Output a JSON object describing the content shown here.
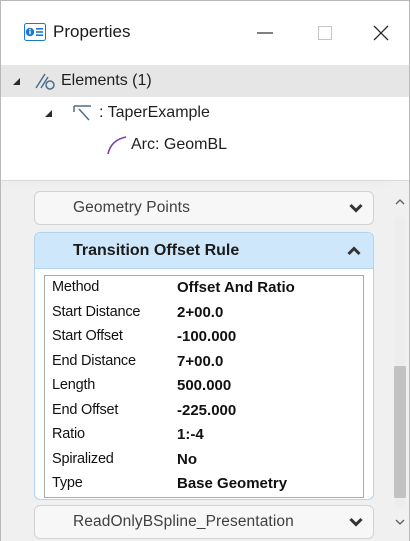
{
  "window": {
    "title": "Properties",
    "minimize_glyph": "—",
    "maximize_glyph": "☐",
    "close_glyph": "✕"
  },
  "tree": {
    "root": {
      "label": "Elements (1)",
      "icon": "elements-icon",
      "expanded": true,
      "selected": true
    },
    "child": {
      "label": ": TaperExample",
      "icon": "taper-icon",
      "expanded": true
    },
    "leaf": {
      "label": "Arc: GeomBL",
      "icon": "arc-icon",
      "color": "#7a3fa6"
    }
  },
  "sections": {
    "geometry_points": {
      "label": "Geometry Points",
      "collapsed": true
    },
    "transition_offset_rule": {
      "label": "Transition Offset Rule",
      "collapsed": false,
      "rows": [
        {
          "name": "Method",
          "value": "Offset And Ratio"
        },
        {
          "name": "Start Distance",
          "value": "2+00.0"
        },
        {
          "name": "Start Offset",
          "value": "-100.000"
        },
        {
          "name": "End Distance",
          "value": "7+00.0"
        },
        {
          "name": "Length",
          "value": "500.000"
        },
        {
          "name": "End Offset",
          "value": "-225.000"
        },
        {
          "name": "Ratio",
          "value": "1:-4"
        },
        {
          "name": "Spiralized",
          "value": "No"
        },
        {
          "name": "Type",
          "value": "Base Geometry"
        }
      ]
    },
    "readonly_bspline": {
      "label": "ReadOnlyBSpline_Presentation",
      "collapsed": true
    }
  },
  "colors": {
    "section_header_bg": "#cfe7fa",
    "section_border": "#b3d4ef",
    "panel_bg": "#f0f0f0",
    "tree_selected_bg": "#e6e6e6",
    "app_icon_blue": "#1b78c8"
  }
}
